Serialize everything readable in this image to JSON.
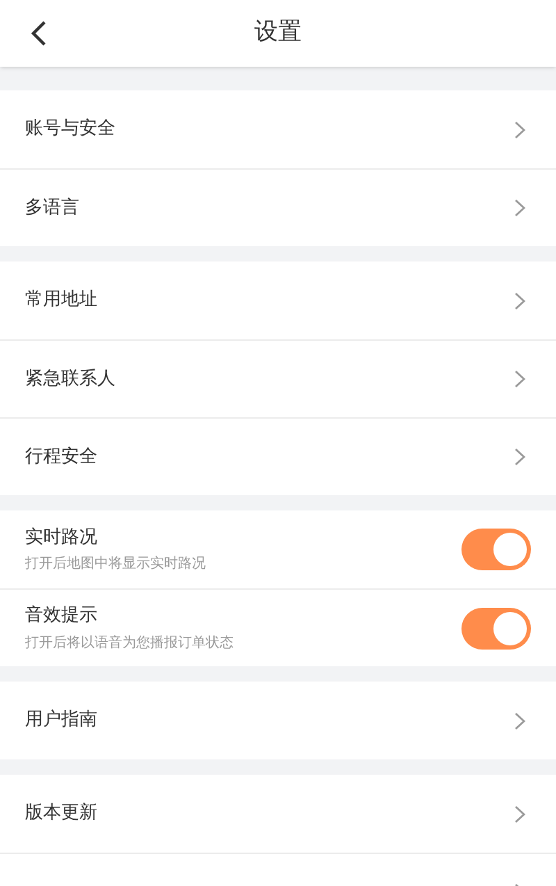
{
  "header": {
    "title": "设置"
  },
  "groups": [
    {
      "items": [
        {
          "kind": "link",
          "label": "账号与安全"
        },
        {
          "kind": "link",
          "label": "多语言"
        }
      ]
    },
    {
      "items": [
        {
          "kind": "link",
          "label": "常用地址"
        },
        {
          "kind": "link",
          "label": "紧急联系人"
        },
        {
          "kind": "link",
          "label": "行程安全"
        }
      ]
    },
    {
      "items": [
        {
          "kind": "toggle",
          "label": "实时路况",
          "description": "打开后地图中将显示实时路况",
          "on": true
        },
        {
          "kind": "toggle",
          "label": "音效提示",
          "description": "打开后将以语音为您播报订单状态",
          "on": true
        }
      ]
    },
    {
      "items": [
        {
          "kind": "link",
          "label": "用户指南"
        }
      ]
    },
    {
      "items": [
        {
          "kind": "link",
          "label": "版本更新"
        },
        {
          "kind": "link"
        }
      ]
    }
  ]
}
